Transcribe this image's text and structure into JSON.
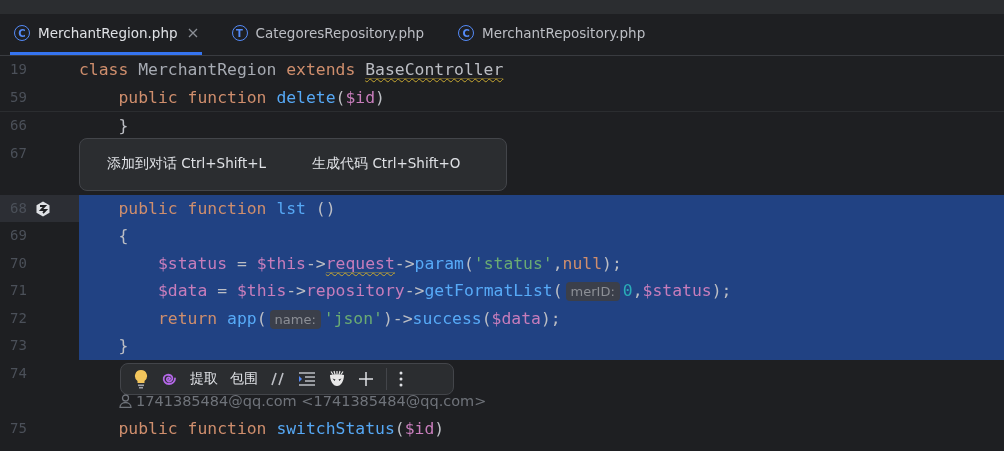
{
  "tabs": [
    {
      "label": "MerchantRegion.php",
      "icon": "C",
      "selected": true,
      "closable": true
    },
    {
      "label": "CategoresRepository.php",
      "icon": "T",
      "selected": false,
      "closable": false
    },
    {
      "label": "MerchantRepository.php",
      "icon": "C",
      "selected": false,
      "closable": false
    }
  ],
  "sticky_lines": [
    {
      "number": "19",
      "tokens": [
        {
          "t": "class ",
          "kind": "kw",
          "warning": false
        },
        {
          "t": "MerchantRegion ",
          "kind": "type",
          "warning": false
        },
        {
          "t": "extends ",
          "kind": "kw",
          "warning": false
        },
        {
          "t": "BaseController",
          "kind": "plain",
          "warning": true
        }
      ]
    },
    {
      "number": "59",
      "tokens": [
        {
          "t": "    public function ",
          "kind": "kw",
          "warning": false
        },
        {
          "t": "delete",
          "kind": "fn",
          "warning": false
        },
        {
          "t": "(",
          "kind": "plain",
          "warning": false
        },
        {
          "t": "$id",
          "kind": "var",
          "warning": false
        },
        {
          "t": ")",
          "kind": "plain",
          "warning": false
        }
      ]
    }
  ],
  "lines": [
    {
      "number": "66",
      "kind": "code",
      "selected": false,
      "current": false,
      "marker": false,
      "tokens": [
        {
          "t": "    }",
          "kind": "plain",
          "warning": false
        }
      ]
    },
    {
      "number": "67",
      "kind": "popup",
      "selected": false,
      "current": false,
      "marker": false
    },
    {
      "number": "68",
      "kind": "code",
      "selected": true,
      "current": true,
      "marker": true,
      "tokens": [
        {
          "t": "    public function ",
          "kind": "kw",
          "warning": false
        },
        {
          "t": "lst ",
          "kind": "fn",
          "warning": false
        },
        {
          "t": "()",
          "kind": "plain",
          "warning": false
        }
      ]
    },
    {
      "number": "69",
      "kind": "code",
      "selected": true,
      "current": false,
      "marker": false,
      "tokens": [
        {
          "t": "    {",
          "kind": "plain",
          "warning": false
        }
      ]
    },
    {
      "number": "70",
      "kind": "code",
      "selected": true,
      "current": false,
      "marker": false,
      "tokens": [
        {
          "t": "        $status",
          "kind": "var",
          "warning": false
        },
        {
          "t": " = ",
          "kind": "plain",
          "warning": false
        },
        {
          "t": "$this",
          "kind": "var",
          "warning": false
        },
        {
          "t": "->",
          "kind": "plain",
          "warning": false
        },
        {
          "t": "request",
          "kind": "var",
          "warning": true
        },
        {
          "t": "->",
          "kind": "plain",
          "warning": false
        },
        {
          "t": "param",
          "kind": "call",
          "warning": false
        },
        {
          "t": "(",
          "kind": "plain",
          "warning": false
        },
        {
          "t": "'status'",
          "kind": "str",
          "warning": false
        },
        {
          "t": ",",
          "kind": "plain",
          "warning": false
        },
        {
          "t": "null",
          "kind": "kw",
          "warning": false
        },
        {
          "t": ");",
          "kind": "plain",
          "warning": false
        }
      ]
    },
    {
      "number": "71",
      "kind": "code",
      "selected": true,
      "current": false,
      "marker": false,
      "tokens": [
        {
          "t": "        $data",
          "kind": "var",
          "warning": false
        },
        {
          "t": " = ",
          "kind": "plain",
          "warning": false
        },
        {
          "t": "$this",
          "kind": "var",
          "warning": false
        },
        {
          "t": "->",
          "kind": "plain",
          "warning": false
        },
        {
          "t": "repository",
          "kind": "var",
          "warning": false
        },
        {
          "t": "->",
          "kind": "plain",
          "warning": false
        },
        {
          "t": "getFormatList",
          "kind": "call",
          "warning": false
        },
        {
          "t": "(",
          "kind": "plain",
          "warning": false
        },
        {
          "t": "merID:",
          "kind": "hint",
          "warning": false
        },
        {
          "t": "0",
          "kind": "num",
          "warning": false
        },
        {
          "t": ",",
          "kind": "plain",
          "warning": false
        },
        {
          "t": "$status",
          "kind": "var",
          "warning": false
        },
        {
          "t": ");",
          "kind": "plain",
          "warning": false
        }
      ]
    },
    {
      "number": "72",
      "kind": "code",
      "selected": true,
      "current": false,
      "marker": false,
      "tokens": [
        {
          "t": "        return ",
          "kind": "kw",
          "warning": false
        },
        {
          "t": "app",
          "kind": "call",
          "warning": false
        },
        {
          "t": "(",
          "kind": "plain",
          "warning": false
        },
        {
          "t": "name:",
          "kind": "hint",
          "warning": false
        },
        {
          "t": "'json'",
          "kind": "str",
          "warning": false
        },
        {
          "t": ")->",
          "kind": "plain",
          "warning": false
        },
        {
          "t": "success",
          "kind": "call",
          "warning": false
        },
        {
          "t": "(",
          "kind": "plain",
          "warning": false
        },
        {
          "t": "$data",
          "kind": "var",
          "warning": false
        },
        {
          "t": ");",
          "kind": "plain",
          "warning": false
        }
      ]
    },
    {
      "number": "73",
      "kind": "code",
      "selected": true,
      "current": false,
      "marker": false,
      "tokens": [
        {
          "t": "    }",
          "kind": "plain",
          "warning": false
        }
      ]
    },
    {
      "number": "74",
      "kind": "toolbar",
      "selected": false,
      "current": false,
      "marker": false
    },
    {
      "kind": "author",
      "selected": false,
      "current": false,
      "marker": false,
      "text": "1741385484@qq.com <1741385484@qq.com>"
    },
    {
      "number": "75",
      "kind": "code",
      "selected": false,
      "current": false,
      "marker": false,
      "tokens": [
        {
          "t": "    public function ",
          "kind": "kw",
          "warning": false
        },
        {
          "t": "switchStatus",
          "kind": "fn",
          "warning": false
        },
        {
          "t": "(",
          "kind": "plain",
          "warning": false
        },
        {
          "t": "$id",
          "kind": "var",
          "warning": false
        },
        {
          "t": ")",
          "kind": "plain",
          "warning": false
        }
      ]
    }
  ],
  "popup": {
    "items": [
      "添加到对话 Ctrl+Shift+L",
      "生成代码 Ctrl+Shift+O"
    ]
  },
  "toolbar": {
    "labels": [
      "提取",
      "包围"
    ]
  }
}
